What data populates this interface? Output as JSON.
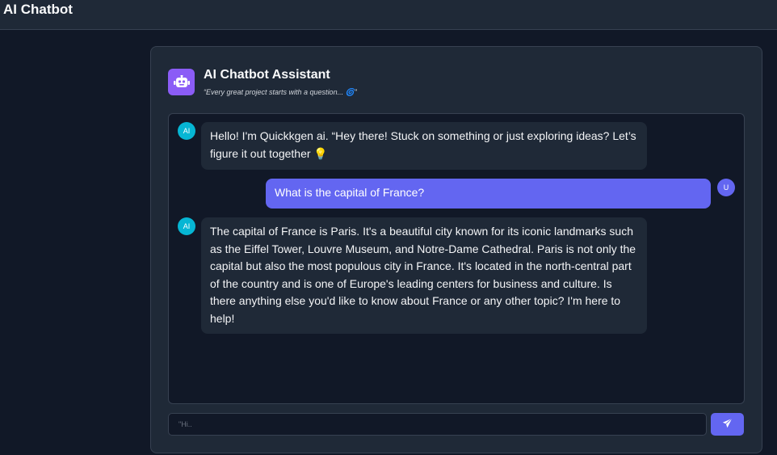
{
  "app": {
    "title": "AI Chatbot"
  },
  "header": {
    "title": "AI Chatbot Assistant",
    "subtitle": "“Every great project starts with a question... 🌀”"
  },
  "messages": [
    {
      "role": "ai",
      "avatar": "AI",
      "text": "Hello! I'm Quickkgen ai. “Hey there! Stuck on something or just exploring ideas? Let’s figure it out together 💡"
    },
    {
      "role": "user",
      "avatar": "U",
      "text": "What is the capital of France?"
    },
    {
      "role": "ai",
      "avatar": "AI",
      "text": "The capital of France is Paris. It's a beautiful city known for its iconic landmarks such as the Eiffel Tower, Louvre Museum, and Notre-Dame Cathedral. Paris is not only the capital but also the most populous city in France. It's located in the north-central part of the country and is one of Europe's leading centers for business and culture. Is there anything else you'd like to know about France or any other topic? I'm here to help!"
    }
  ],
  "input": {
    "placeholder": "\"Hi..",
    "value": ""
  },
  "send_button": {
    "icon": "send-icon"
  },
  "colors": {
    "background": "#111827",
    "panel": "#1f2937",
    "accent": "#6366f1",
    "ai_avatar": "#06b6d4",
    "bot_logo": "#8b5cf6"
  }
}
